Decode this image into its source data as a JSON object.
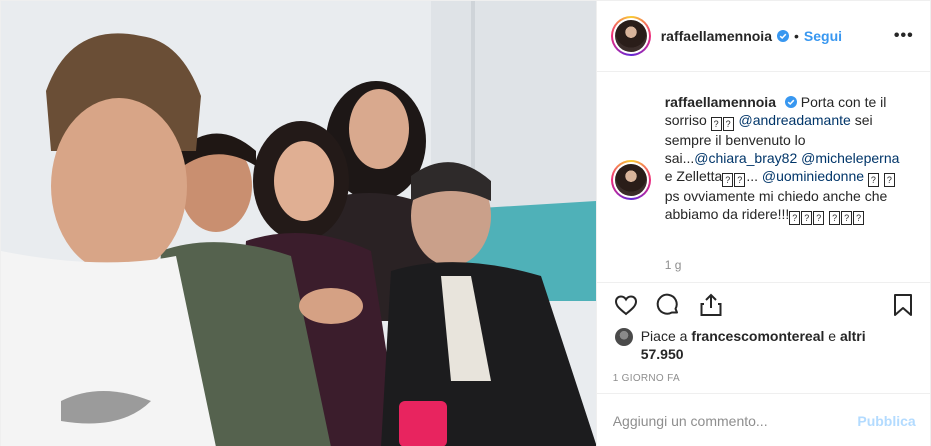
{
  "post": {
    "image_alt": "Selfie di gruppo di cinque persone",
    "header": {
      "username": "raffaellamennoia",
      "separator": "•",
      "follow_label": "Segui",
      "more_label": "•••"
    },
    "caption": {
      "username": "raffaellamennoia",
      "text_1": "Porta con te il sorriso",
      "mention_1": "@andreadamante",
      "text_2": "sei sempre il benvenuto lo sai...",
      "mention_2": "@chiara_bray82",
      "mention_3": "@micheleperna",
      "text_3": "e Zelletta",
      "text_4": "...",
      "mention_4": "@uominiedonne",
      "text_5": "ps ovviamente mi chiedo anche che abbiamo da ridere!!!",
      "glyph": "?",
      "time": "1 g"
    },
    "actions": {
      "like": "like",
      "comment": "comment",
      "share": "share",
      "save": "save"
    },
    "likes": {
      "prefix": "Piace a",
      "user": "francescomontereal",
      "connector": "e",
      "others": "altri 57.950"
    },
    "date": "1 GIORNO FA",
    "comment_box": {
      "placeholder": "Aggiungi un commento...",
      "publish_label": "Pubblica"
    },
    "colors": {
      "accent": "#3897f0",
      "mention": "#003569",
      "muted": "#8e8e8e",
      "publish_disabled": "#b3dbff"
    }
  }
}
